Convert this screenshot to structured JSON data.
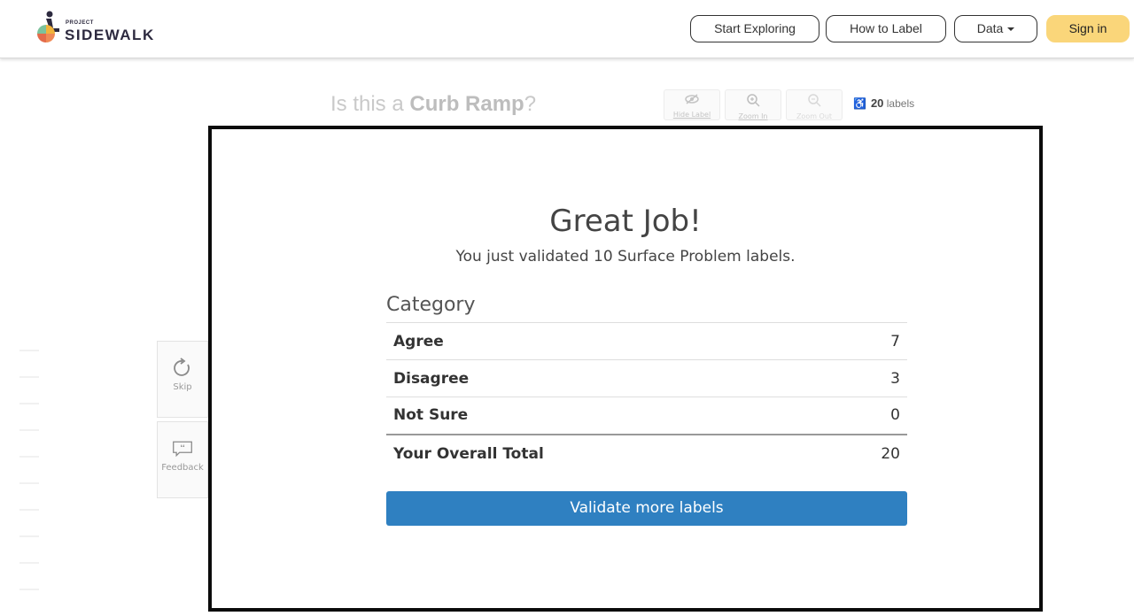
{
  "navbar": {
    "logo_small": "PROJECT",
    "logo_name": "SIDEWALK",
    "start_exploring": "Start Exploring",
    "how_to_label": "How to Label",
    "data": "Data",
    "sign_in": "Sign in",
    "signin_color": "#fad67a"
  },
  "toolbar": {
    "question_prefix": "Is this a",
    "question_type": "Curb Ramp",
    "question_suffix": "?",
    "hide_label": "Hide Label",
    "zoom_in": "Zoom In",
    "zoom_out": "Zoom Out",
    "count": "20",
    "count_unit": "labels"
  },
  "side": {
    "skip": "Skip",
    "feedback": "Feedback"
  },
  "modal": {
    "title": "Great Job!",
    "subtitle": "You just validated 10 Surface Problem labels.",
    "category_header": "Category",
    "rows": [
      {
        "label": "Agree",
        "value": "7"
      },
      {
        "label": "Disagree",
        "value": "3"
      },
      {
        "label": "Not Sure",
        "value": "0"
      }
    ],
    "total_label": "Your Overall Total",
    "total_value": "20",
    "button": "Validate more labels",
    "button_color": "#2f80c1"
  }
}
